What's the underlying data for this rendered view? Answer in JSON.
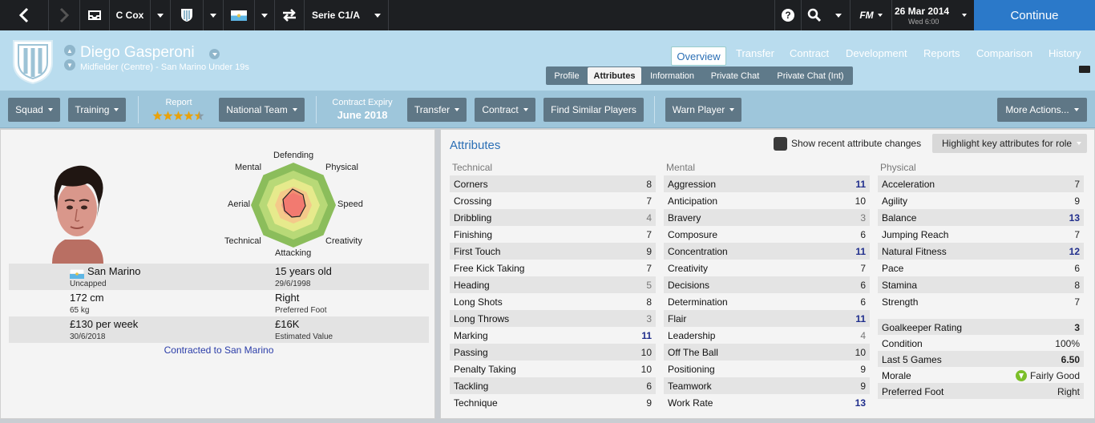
{
  "topbar": {
    "manager": "C Cox",
    "competition": "Serie C1/A",
    "fm_label": "FM",
    "date": "26 Mar 2014",
    "time": "Wed 6:00",
    "continue_label": "Continue",
    "icons": [
      "back-arrow-icon",
      "forward-arrow-icon",
      "inbox-icon",
      "club-crest-icon",
      "nation-flag-icon",
      "swap-icon",
      "help-icon",
      "search-icon"
    ]
  },
  "player": {
    "name": "Diego Gasperoni",
    "subtitle": "Midfielder (Centre) - San Marino Under 19s"
  },
  "tabs": [
    {
      "label": "Overview"
    },
    {
      "label": "Transfer"
    },
    {
      "label": "Contract"
    },
    {
      "label": "Development"
    },
    {
      "label": "Reports"
    },
    {
      "label": "Comparison"
    },
    {
      "label": "History"
    }
  ],
  "subtabs": [
    {
      "label": "Profile"
    },
    {
      "label": "Attributes"
    },
    {
      "label": "Information"
    },
    {
      "label": "Private Chat"
    },
    {
      "label": "Private Chat (Int)"
    }
  ],
  "actions": {
    "squad": "Squad",
    "training": "Training",
    "report_label": "Report",
    "report_stars": 4.5,
    "national_team": "National Team",
    "contract_expiry_label": "Contract Expiry",
    "contract_expiry_value": "June 2018",
    "transfer": "Transfer",
    "contract": "Contract",
    "find_similar": "Find Similar Players",
    "warn_player": "Warn Player",
    "more_actions": "More Actions..."
  },
  "radar": {
    "labels": {
      "defending": "Defending",
      "physical": "Physical",
      "speed": "Speed",
      "creativity": "Creativity",
      "attacking": "Attacking",
      "technical": "Technical",
      "aerial": "Aerial",
      "mental": "Mental"
    }
  },
  "details": {
    "nation": "San Marino",
    "caps": "Uncapped",
    "age": "15 years old",
    "dob": "29/6/1998",
    "height": "172 cm",
    "weight": "65 kg",
    "foot_value": "Right",
    "foot_label": "Preferred Foot",
    "wage": "£130 per week",
    "contract_end": "30/6/2018",
    "value": "£16K",
    "value_label": "Estimated Value",
    "contracted_to": "Contracted to San Marino"
  },
  "attributes": {
    "title": "Attributes",
    "show_changes_label": "Show recent attribute changes",
    "highlight_label": "Highlight key attributes for role",
    "technical_head": "Technical",
    "mental_head": "Mental",
    "physical_head": "Physical",
    "technical": [
      {
        "name": "Corners",
        "value": "8"
      },
      {
        "name": "Crossing",
        "value": "7"
      },
      {
        "name": "Dribbling",
        "value": "4"
      },
      {
        "name": "Finishing",
        "value": "7"
      },
      {
        "name": "First Touch",
        "value": "9"
      },
      {
        "name": "Free Kick Taking",
        "value": "7"
      },
      {
        "name": "Heading",
        "value": "5"
      },
      {
        "name": "Long Shots",
        "value": "8"
      },
      {
        "name": "Long Throws",
        "value": "3"
      },
      {
        "name": "Marking",
        "value": "11"
      },
      {
        "name": "Passing",
        "value": "10"
      },
      {
        "name": "Penalty Taking",
        "value": "10"
      },
      {
        "name": "Tackling",
        "value": "6"
      },
      {
        "name": "Technique",
        "value": "9"
      }
    ],
    "mental": [
      {
        "name": "Aggression",
        "value": "11"
      },
      {
        "name": "Anticipation",
        "value": "10"
      },
      {
        "name": "Bravery",
        "value": "3"
      },
      {
        "name": "Composure",
        "value": "6"
      },
      {
        "name": "Concentration",
        "value": "11"
      },
      {
        "name": "Creativity",
        "value": "7"
      },
      {
        "name": "Decisions",
        "value": "6"
      },
      {
        "name": "Determination",
        "value": "6"
      },
      {
        "name": "Flair",
        "value": "11"
      },
      {
        "name": "Leadership",
        "value": "4"
      },
      {
        "name": "Off The Ball",
        "value": "10"
      },
      {
        "name": "Positioning",
        "value": "9"
      },
      {
        "name": "Teamwork",
        "value": "9"
      },
      {
        "name": "Work Rate",
        "value": "13"
      }
    ],
    "physical": [
      {
        "name": "Acceleration",
        "value": "7"
      },
      {
        "name": "Agility",
        "value": "9"
      },
      {
        "name": "Balance",
        "value": "13"
      },
      {
        "name": "Jumping Reach",
        "value": "7"
      },
      {
        "name": "Natural Fitness",
        "value": "12"
      },
      {
        "name": "Pace",
        "value": "6"
      },
      {
        "name": "Stamina",
        "value": "8"
      },
      {
        "name": "Strength",
        "value": "7"
      }
    ],
    "extra": [
      {
        "name": "Goalkeeper Rating",
        "value": "3"
      },
      {
        "name": "Condition",
        "value": "100%"
      },
      {
        "name": "Last 5 Games",
        "value": "6.50"
      },
      {
        "name": "Morale",
        "value": "Fairly Good"
      },
      {
        "name": "Preferred Foot",
        "value": "Right"
      }
    ]
  }
}
